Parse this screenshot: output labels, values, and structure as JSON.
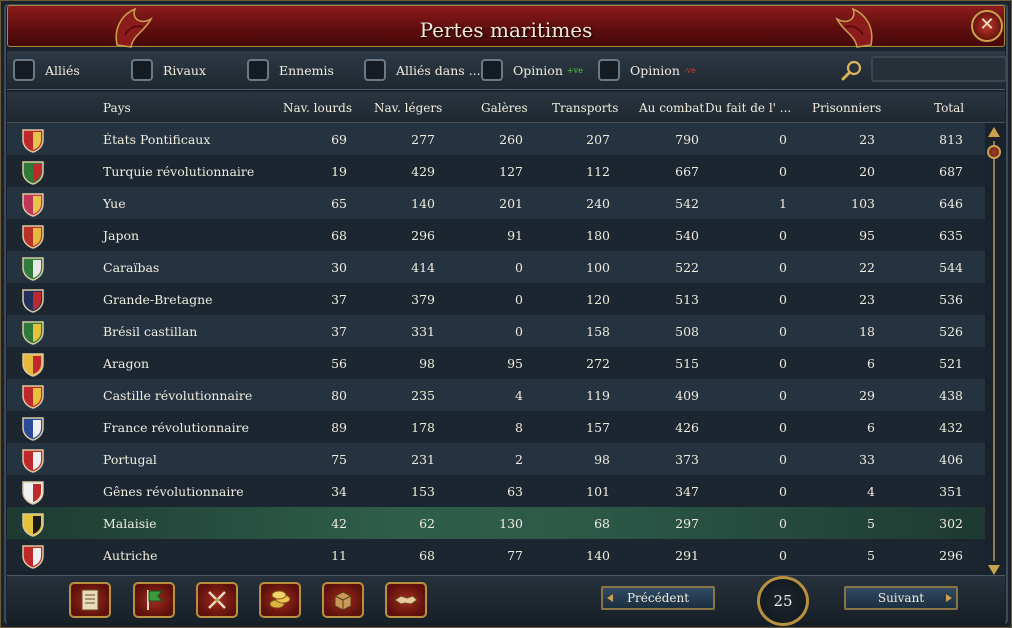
{
  "window": {
    "title": "Pertes maritimes"
  },
  "filters": [
    {
      "label": "Alliés",
      "suffix": ""
    },
    {
      "label": "Rivaux",
      "suffix": ""
    },
    {
      "label": "Ennemis",
      "suffix": ""
    },
    {
      "label": "Alliés dans ...",
      "suffix": ""
    },
    {
      "label": "Opinion",
      "suffix": "+ve"
    },
    {
      "label": "Opinion",
      "suffix": "-ve"
    }
  ],
  "search": {
    "value": ""
  },
  "columns": [
    "Pays",
    "Nav. lourds",
    "Nav. légers",
    "Galères",
    "Transports",
    "Au combat",
    "Du fait de l' ...",
    "Prisonniers",
    "Total"
  ],
  "rows": [
    {
      "country": "États Pontificaux",
      "heavy": "69",
      "light": "277",
      "galleys": "260",
      "transports": "207",
      "combat": "790",
      "attrition": "0",
      "prisoners": "23",
      "total": "813",
      "colors": [
        "#c0292b",
        "#e8c34a"
      ]
    },
    {
      "country": "Turquie révolutionnaire",
      "heavy": "19",
      "light": "429",
      "galleys": "127",
      "transports": "112",
      "combat": "667",
      "attrition": "0",
      "prisoners": "20",
      "total": "687",
      "colors": [
        "#2f7a3a",
        "#c0292b"
      ]
    },
    {
      "country": "Yue",
      "heavy": "65",
      "light": "140",
      "galleys": "201",
      "transports": "240",
      "combat": "542",
      "attrition": "1",
      "prisoners": "103",
      "total": "646",
      "colors": [
        "#c2365a",
        "#e8c34a"
      ]
    },
    {
      "country": "Japon",
      "heavy": "68",
      "light": "296",
      "galleys": "91",
      "transports": "180",
      "combat": "540",
      "attrition": "0",
      "prisoners": "95",
      "total": "635",
      "colors": [
        "#b8322a",
        "#e6b83c"
      ]
    },
    {
      "country": "Caraïbas",
      "heavy": "30",
      "light": "414",
      "galleys": "0",
      "transports": "100",
      "combat": "522",
      "attrition": "0",
      "prisoners": "22",
      "total": "544",
      "colors": [
        "#2e7c3e",
        "#e8e8e8"
      ]
    },
    {
      "country": "Grande-Bretagne",
      "heavy": "37",
      "light": "379",
      "galleys": "0",
      "transports": "120",
      "combat": "513",
      "attrition": "0",
      "prisoners": "23",
      "total": "536",
      "colors": [
        "#22305e",
        "#c0292b"
      ]
    },
    {
      "country": "Brésil castillan",
      "heavy": "37",
      "light": "331",
      "galleys": "0",
      "transports": "158",
      "combat": "508",
      "attrition": "0",
      "prisoners": "18",
      "total": "526",
      "colors": [
        "#2f7a3a",
        "#e6c23a"
      ]
    },
    {
      "country": "Aragon",
      "heavy": "56",
      "light": "98",
      "galleys": "95",
      "transports": "272",
      "combat": "515",
      "attrition": "0",
      "prisoners": "6",
      "total": "521",
      "colors": [
        "#e6b83c",
        "#c0292b"
      ]
    },
    {
      "country": "Castille révolutionnaire",
      "heavy": "80",
      "light": "235",
      "galleys": "4",
      "transports": "119",
      "combat": "409",
      "attrition": "0",
      "prisoners": "29",
      "total": "438",
      "colors": [
        "#c0292b",
        "#e6c23a"
      ]
    },
    {
      "country": "France révolutionnaire",
      "heavy": "89",
      "light": "178",
      "galleys": "8",
      "transports": "157",
      "combat": "426",
      "attrition": "0",
      "prisoners": "6",
      "total": "432",
      "colors": [
        "#2a4a9a",
        "#f0f0f0"
      ]
    },
    {
      "country": "Portugal",
      "heavy": "75",
      "light": "231",
      "galleys": "2",
      "transports": "98",
      "combat": "373",
      "attrition": "0",
      "prisoners": "33",
      "total": "406",
      "colors": [
        "#c0292b",
        "#f0f0f0"
      ]
    },
    {
      "country": "Gênes révolutionnaire",
      "heavy": "34",
      "light": "153",
      "galleys": "63",
      "transports": "101",
      "combat": "347",
      "attrition": "0",
      "prisoners": "4",
      "total": "351",
      "colors": [
        "#f0f0f0",
        "#c0292b"
      ]
    },
    {
      "country": "Malaisie",
      "heavy": "42",
      "light": "62",
      "galleys": "130",
      "transports": "68",
      "combat": "297",
      "attrition": "0",
      "prisoners": "5",
      "total": "302",
      "colors": [
        "#e6c23a",
        "#1a1a1a"
      ]
    },
    {
      "country": "Autriche",
      "heavy": "11",
      "light": "68",
      "galleys": "77",
      "transports": "140",
      "combat": "291",
      "attrition": "0",
      "prisoners": "5",
      "total": "296",
      "colors": [
        "#c0292b",
        "#f0f0f0"
      ]
    }
  ],
  "selected_row": "Malaisie",
  "toolbar": {
    "icons": [
      "ledger-icon",
      "flag-icon",
      "crossed-swords-icon",
      "coins-icon",
      "trade-crate-icon",
      "handshake-icon"
    ]
  },
  "pagination": {
    "prev_label": "Précédent",
    "next_label": "Suivant",
    "page": "25"
  }
}
